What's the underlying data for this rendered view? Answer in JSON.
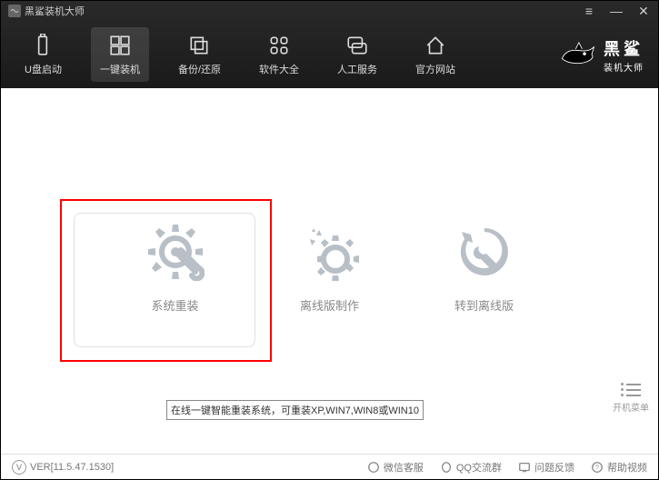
{
  "app": {
    "title": "黑鲨装机大师"
  },
  "brand": {
    "line1": "黑鲨",
    "line2": "装机大师"
  },
  "nav": {
    "items": [
      {
        "label": "U盘启动"
      },
      {
        "label": "一键装机"
      },
      {
        "label": "备份/还原"
      },
      {
        "label": "软件大全"
      },
      {
        "label": "人工服务"
      },
      {
        "label": "官方网站"
      }
    ],
    "active_index": 1
  },
  "features": {
    "items": [
      {
        "label": "系统重装"
      },
      {
        "label": "离线版制作"
      },
      {
        "label": "转到离线版"
      }
    ],
    "tooltip": "在线一键智能重装系统，可重装XP,WIN7,WIN8或WIN10"
  },
  "boot_menu": {
    "label": "开机菜单"
  },
  "statusbar": {
    "version": "VER[11.5.47.1530]",
    "ver_symbol": "V",
    "items": [
      {
        "label": "微信客服"
      },
      {
        "label": "QQ交流群"
      },
      {
        "label": "问题反馈"
      },
      {
        "label": "帮助视频"
      }
    ]
  }
}
